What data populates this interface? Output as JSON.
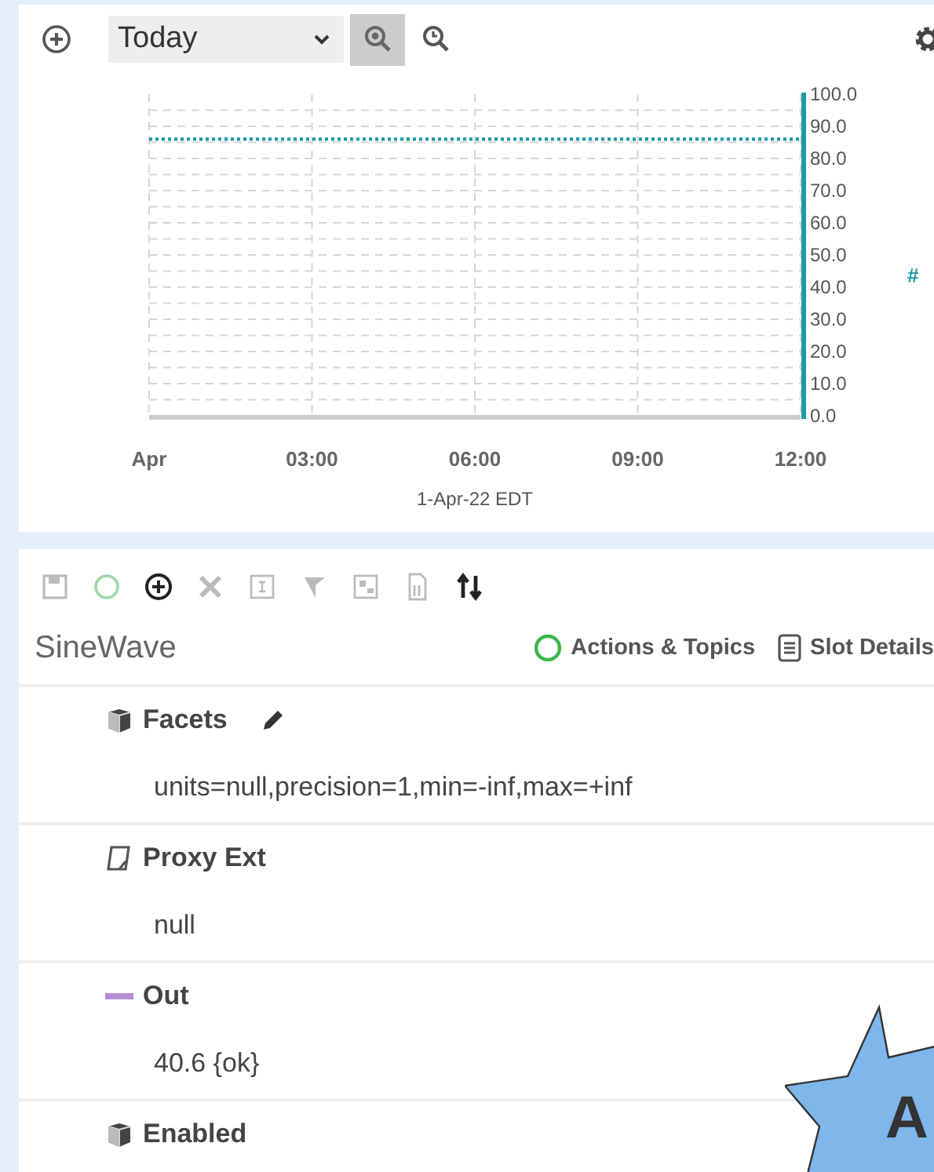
{
  "chart_panel": {
    "range_select": {
      "value": "Today"
    },
    "zoom_active": true,
    "chart_data": {
      "type": "line",
      "xlabel": "1-Apr-22 EDT",
      "categories": [
        "Apr",
        "03:00",
        "06:00",
        "09:00",
        "12:00"
      ],
      "grid": true,
      "series": [
        {
          "color": "#1a9aa8",
          "line_style": "dotted",
          "values": [
            86,
            86,
            86,
            86,
            86
          ]
        }
      ],
      "ylim": [
        0,
        100
      ],
      "yticks": [
        {
          "value": 0,
          "label": "0.0"
        },
        {
          "value": 10,
          "label": "10.0"
        },
        {
          "value": 20,
          "label": "20.0"
        },
        {
          "value": 30,
          "label": "30.0"
        },
        {
          "value": 40,
          "label": "40.0"
        },
        {
          "value": 50,
          "label": "50.0"
        },
        {
          "value": 60,
          "label": "60.0"
        },
        {
          "value": 70,
          "label": "70.0"
        },
        {
          "value": 80,
          "label": "80.0"
        },
        {
          "value": 90,
          "label": "90.0"
        },
        {
          "value": 100,
          "label": "100.0"
        }
      ]
    },
    "axis_marker": "#"
  },
  "toolbar": [
    {
      "kind": "save",
      "disabled": true
    },
    {
      "kind": "circle",
      "disabled": true
    },
    {
      "kind": "add",
      "disabled": false
    },
    {
      "kind": "delete",
      "disabled": true
    },
    {
      "kind": "rename",
      "disabled": true
    },
    {
      "kind": "flag",
      "disabled": true
    },
    {
      "kind": "grid",
      "disabled": true
    },
    {
      "kind": "doc",
      "disabled": true
    },
    {
      "kind": "sort",
      "disabled": false
    }
  ],
  "component": {
    "title": "SineWave",
    "links": [
      {
        "kind": "actions",
        "label": "Actions & Topics"
      },
      {
        "kind": "slots",
        "label": "Slot Details"
      }
    ]
  },
  "properties": [
    {
      "kind": "cube",
      "label": "Facets",
      "editable": true,
      "value": "units=null,precision=1,min=-inf,max=+inf"
    },
    {
      "kind": "proxy",
      "label": "Proxy Ext",
      "editable": false,
      "value": "null"
    },
    {
      "kind": "out",
      "label": "Out",
      "editable": false,
      "value": "40.6 {ok}"
    },
    {
      "kind": "cube",
      "label": "Enabled",
      "editable": false
    }
  ],
  "callout": {
    "text": "A"
  }
}
